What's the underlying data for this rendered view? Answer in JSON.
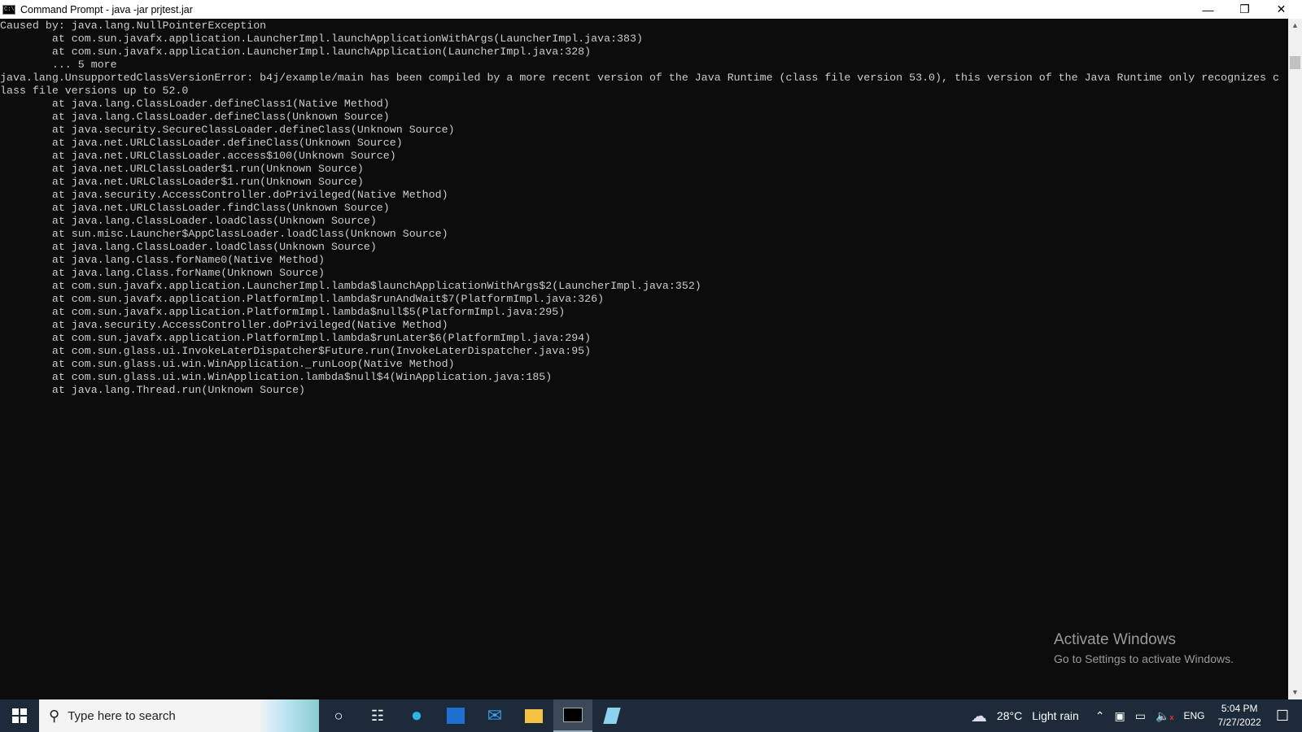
{
  "window": {
    "title": "Command Prompt - java  -jar prjtest.jar",
    "icon": "cmd-icon"
  },
  "console_lines": [
    "Caused by: java.lang.NullPointerException",
    "        at com.sun.javafx.application.LauncherImpl.launchApplicationWithArgs(LauncherImpl.java:383)",
    "        at com.sun.javafx.application.LauncherImpl.launchApplication(LauncherImpl.java:328)",
    "        ... 5 more",
    "java.lang.UnsupportedClassVersionError: b4j/example/main has been compiled by a more recent version of the Java Runtime (class file version 53.0), this version of the Java Runtime only recognizes c",
    "lass file versions up to 52.0",
    "        at java.lang.ClassLoader.defineClass1(Native Method)",
    "        at java.lang.ClassLoader.defineClass(Unknown Source)",
    "        at java.security.SecureClassLoader.defineClass(Unknown Source)",
    "        at java.net.URLClassLoader.defineClass(Unknown Source)",
    "        at java.net.URLClassLoader.access$100(Unknown Source)",
    "        at java.net.URLClassLoader$1.run(Unknown Source)",
    "        at java.net.URLClassLoader$1.run(Unknown Source)",
    "        at java.security.AccessController.doPrivileged(Native Method)",
    "        at java.net.URLClassLoader.findClass(Unknown Source)",
    "        at java.lang.ClassLoader.loadClass(Unknown Source)",
    "        at sun.misc.Launcher$AppClassLoader.loadClass(Unknown Source)",
    "        at java.lang.ClassLoader.loadClass(Unknown Source)",
    "        at java.lang.Class.forName0(Native Method)",
    "        at java.lang.Class.forName(Unknown Source)",
    "        at com.sun.javafx.application.LauncherImpl.lambda$launchApplicationWithArgs$2(LauncherImpl.java:352)",
    "        at com.sun.javafx.application.PlatformImpl.lambda$runAndWait$7(PlatformImpl.java:326)",
    "        at com.sun.javafx.application.PlatformImpl.lambda$null$5(PlatformImpl.java:295)",
    "        at java.security.AccessController.doPrivileged(Native Method)",
    "        at com.sun.javafx.application.PlatformImpl.lambda$runLater$6(PlatformImpl.java:294)",
    "        at com.sun.glass.ui.InvokeLaterDispatcher$Future.run(InvokeLaterDispatcher.java:95)",
    "        at com.sun.glass.ui.win.WinApplication._runLoop(Native Method)",
    "        at com.sun.glass.ui.win.WinApplication.lambda$null$4(WinApplication.java:185)",
    "        at java.lang.Thread.run(Unknown Source)"
  ],
  "watermark": {
    "title": "Activate Windows",
    "subtitle": "Go to Settings to activate Windows."
  },
  "taskbar": {
    "search_placeholder": "Type here to search",
    "weather": {
      "temp": "28°C",
      "condition": "Light rain"
    },
    "language": "ENG",
    "time": "5:04 PM",
    "date": "7/27/2022"
  }
}
